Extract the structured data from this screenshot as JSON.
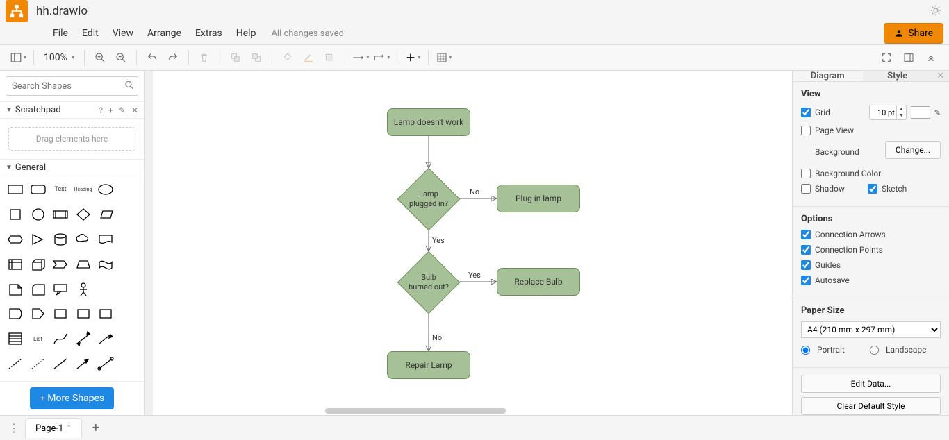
{
  "filename": "hh.drawio",
  "menus": {
    "file": "File",
    "edit": "Edit",
    "view": "View",
    "arrange": "Arrange",
    "extras": "Extras",
    "help": "Help"
  },
  "status": "All changes saved",
  "share_label": "Share",
  "zoom": "100%",
  "search": {
    "placeholder": "Search Shapes"
  },
  "scratchpad": {
    "title": "Scratchpad",
    "hint": "Drag elements here",
    "help": "?"
  },
  "general": {
    "title": "General",
    "text_label": "Text",
    "heading_label": "Heading"
  },
  "more_shapes": "+ More Shapes",
  "flow": {
    "start": "Lamp doesn't work",
    "d1": "Lamp\nplugged in?",
    "a1": "Plug in lamp",
    "d2": "Bulb\nburned out?",
    "a2": "Replace Bulb",
    "end": "Repair Lamp",
    "no": "No",
    "yes": "Yes"
  },
  "right": {
    "tab_diagram": "Diagram",
    "tab_style": "Style",
    "view": "View",
    "grid": "Grid",
    "grid_val": "10 pt",
    "page_view": "Page View",
    "background": "Background",
    "change": "Change...",
    "bg_color": "Background Color",
    "shadow": "Shadow",
    "sketch": "Sketch",
    "options": "Options",
    "conn_arrows": "Connection Arrows",
    "conn_points": "Connection Points",
    "guides": "Guides",
    "autosave": "Autosave",
    "paper_size": "Paper Size",
    "paper_val": "A4 (210 mm x 297 mm)",
    "portrait": "Portrait",
    "landscape": "Landscape",
    "edit_data": "Edit Data...",
    "clear_style": "Clear Default Style"
  },
  "page_tab": "Page-1"
}
